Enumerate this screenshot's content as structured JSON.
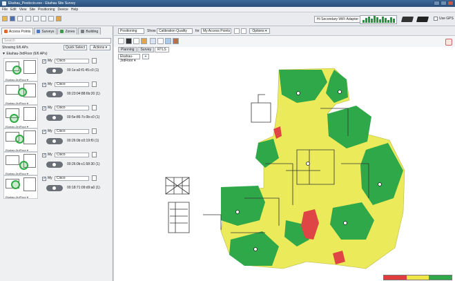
{
  "window": {
    "title": "Ekahau_Pesticcio.esx - Ekahau Site Survey"
  },
  "menu": [
    "File",
    "Edit",
    "View",
    "Site",
    "Positioning",
    "Device",
    "Help"
  ],
  "adapter": {
    "label": "Hi Secondary WiFi Adapter"
  },
  "gps": {
    "label": "Use GPS"
  },
  "left_tabs": [
    {
      "label": "Access Points",
      "color": "#e06a2a"
    },
    {
      "label": "Surveys",
      "color": "#4a78c2"
    },
    {
      "label": "Zones",
      "color": "#3a9a4a"
    },
    {
      "label": "Building",
      "color": "#7a7a7a"
    }
  ],
  "search": {
    "placeholder": "Search"
  },
  "showing": "Showing 6/6 APs",
  "quick_select": "Quick Select",
  "actions": "Actions ▾",
  "floor_tree": "▼ Ekahau-3rdFloor (6/6 APs)",
  "aps": [
    {
      "on": "My",
      "vendor": "Cisco",
      "mac": "00:1e:a0:f1:45:c0 (1)",
      "loc": "Ekahau-3rdFloor ▾"
    },
    {
      "on": "My",
      "vendor": "Cisco",
      "mac": "00:23:04:88:6b:20 (1)",
      "loc": "Ekahau-3rdFloor ▾"
    },
    {
      "on": "My",
      "vendor": "Cisco",
      "mac": "00:5e:86:7c:0b:c0 (1)",
      "loc": "Ekahau-3rdFloor ▾"
    },
    {
      "on": "My",
      "vendor": "Cisco",
      "mac": "00:26:0b:c0:19:f0 (1)",
      "loc": "Ekahau-3rdFloor ▾"
    },
    {
      "on": "My",
      "vendor": "Cisco",
      "mac": "00:26:0b:c1:58:30 (1)",
      "loc": "Ekahau-3rdFloor ▾"
    },
    {
      "on": "My",
      "vendor": "Cisco",
      "mac": "00:18:71:09:d9:a0 (1)",
      "loc": "Ekahau-3rdFloor ▾"
    }
  ],
  "right_toolbar": {
    "positioning": "Positioning",
    "show_label": "Show",
    "show_value": "Calibration Quality",
    "for_label": "for",
    "for_value": "My Access Points",
    "options": "Options ▾"
  },
  "view_tabs": [
    "Planning",
    "Survey",
    "RTLS"
  ],
  "floor": {
    "value": "Ekahau-3rdFloor ▾",
    "add": "+"
  },
  "legend_colors": [
    "#e03c3c",
    "#f0e64a",
    "#2fa84a"
  ],
  "colors": {
    "green": "#2fa84a",
    "yellow": "#eaea5a",
    "red": "#e04545"
  }
}
